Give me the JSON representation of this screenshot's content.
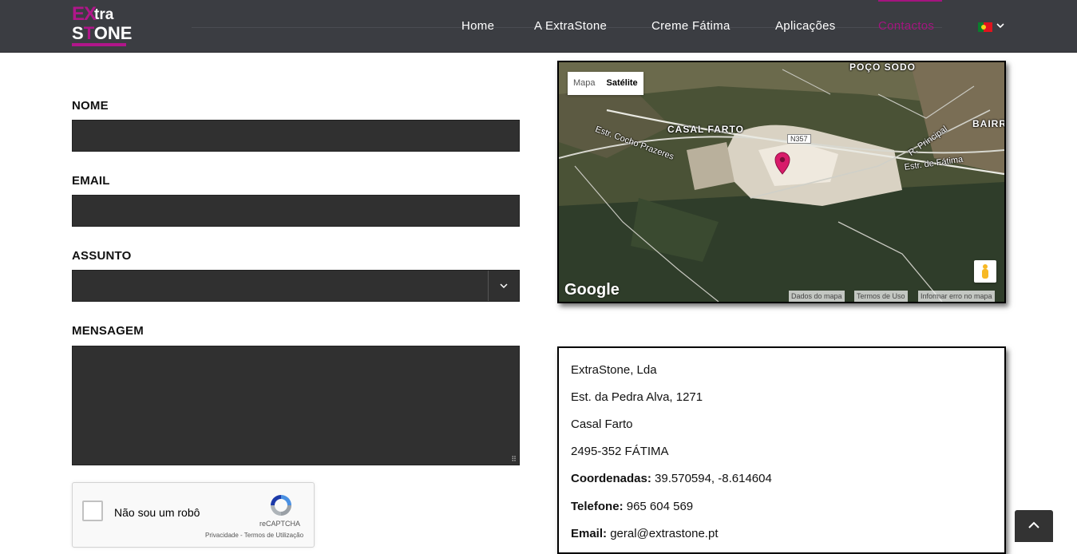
{
  "logo": {
    "part1": "EX",
    "part2": "tra",
    "part3a": "S",
    "part3b": "T",
    "part3c": "ONE",
    "alt": "ExtraStone"
  },
  "nav": {
    "items": [
      {
        "label": "Home",
        "active": false
      },
      {
        "label": "A ExtraStone",
        "active": false
      },
      {
        "label": "Creme Fátima",
        "active": false
      },
      {
        "label": "Aplicações",
        "active": false
      },
      {
        "label": "Contactos",
        "active": true
      }
    ],
    "language": "pt-flag",
    "accent": "#a4147f"
  },
  "form": {
    "name_label": "NOME",
    "email_label": "EMAIL",
    "subject_label": "ASSUNTO",
    "message_label": "MENSAGEM",
    "name_value": "",
    "email_value": "",
    "subject_value": "",
    "message_value": "",
    "field_color": "#303030"
  },
  "captcha": {
    "label": "Não sou um robô",
    "brand": "reCAPTCHA",
    "links": "Privacidade - Termos de Utilização"
  },
  "map": {
    "type_map": "Mapa",
    "type_satellite": "Satélite",
    "places": [
      "POÇO SODO",
      "CASAL FARTO",
      "BAIRRO"
    ],
    "roads": [
      "Estr. Cocho Prazeres",
      "R. Principal",
      "Estr. de Fátima"
    ],
    "route": "N357",
    "google": "Google",
    "attribution": [
      "Dados do mapa",
      "Termos de Uso",
      "Informar erro no mapa"
    ],
    "marker_color": "#d81b6a"
  },
  "contact": {
    "company": "ExtraStone, Lda",
    "street": "Est. da Pedra Alva, 1271",
    "locality": "Casal Farto",
    "postcode": "2495-352 FÁTIMA",
    "coords_label": "Coordenadas:",
    "coords_value": "39.570594, -8.614604",
    "phone_label": "Telefone:",
    "phone_value": "965 604 569",
    "email_label": "Email:",
    "email_value": "geral@extrastone.pt"
  },
  "back_to_top": "chevron-up-icon"
}
